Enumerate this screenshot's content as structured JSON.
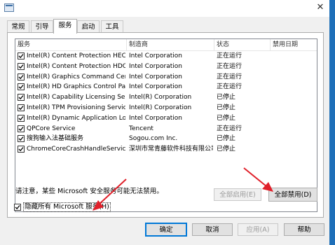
{
  "close_icon_glyph": "✕",
  "tabs": [
    "常规",
    "引导",
    "服务",
    "启动",
    "工具"
  ],
  "active_tab": 2,
  "columns": [
    "服务",
    "制造商",
    "状态",
    "禁用日期"
  ],
  "services": [
    {
      "name": "Intel(R) Content Protection HECI ...",
      "maker": "Intel Corporation",
      "status": "正在运行",
      "disabled_date": ""
    },
    {
      "name": "Intel(R) Content Protection HDCP...",
      "maker": "Intel Corporation",
      "status": "正在运行",
      "disabled_date": ""
    },
    {
      "name": "Intel(R) Graphics Command Cent...",
      "maker": "Intel Corporation",
      "status": "正在运行",
      "disabled_date": ""
    },
    {
      "name": "Intel(R) HD Graphics Control Pan...",
      "maker": "Intel Corporation",
      "status": "正在运行",
      "disabled_date": ""
    },
    {
      "name": "Intel(R) Capability Licensing Servi...",
      "maker": "Intel(R) Corporation",
      "status": "已停止",
      "disabled_date": ""
    },
    {
      "name": "Intel(R) TPM Provisioning Service",
      "maker": "Intel(R) Corporation",
      "status": "已停止",
      "disabled_date": ""
    },
    {
      "name": "Intel(R) Dynamic Application Loa...",
      "maker": "Intel Corporation",
      "status": "已停止",
      "disabled_date": ""
    },
    {
      "name": "QPCore Service",
      "maker": "Tencent",
      "status": "正在运行",
      "disabled_date": ""
    },
    {
      "name": "搜狗输入法基础服务",
      "maker": "Sogou.com Inc.",
      "status": "已停止",
      "disabled_date": ""
    },
    {
      "name": "ChromeCoreCrashHandleService",
      "maker": "深圳市常青藤软件科技有限公司",
      "status": "已停止",
      "disabled_date": ""
    }
  ],
  "note": "请注意，某些 Microsoft 安全服务可能无法禁用。",
  "enable_all_label": "全部启用(E)",
  "disable_all_label": "全部禁用(D)",
  "hide_ms_label": "隐藏所有 Microsoft 服务(H)",
  "hide_ms_checked": true,
  "ok_label": "确定",
  "cancel_label": "取消",
  "apply_label": "应用(A)",
  "help_label": "帮助",
  "colors": {
    "arrow": "#e0202a",
    "accent": "#0078d7",
    "desktop": "#1672c4"
  }
}
